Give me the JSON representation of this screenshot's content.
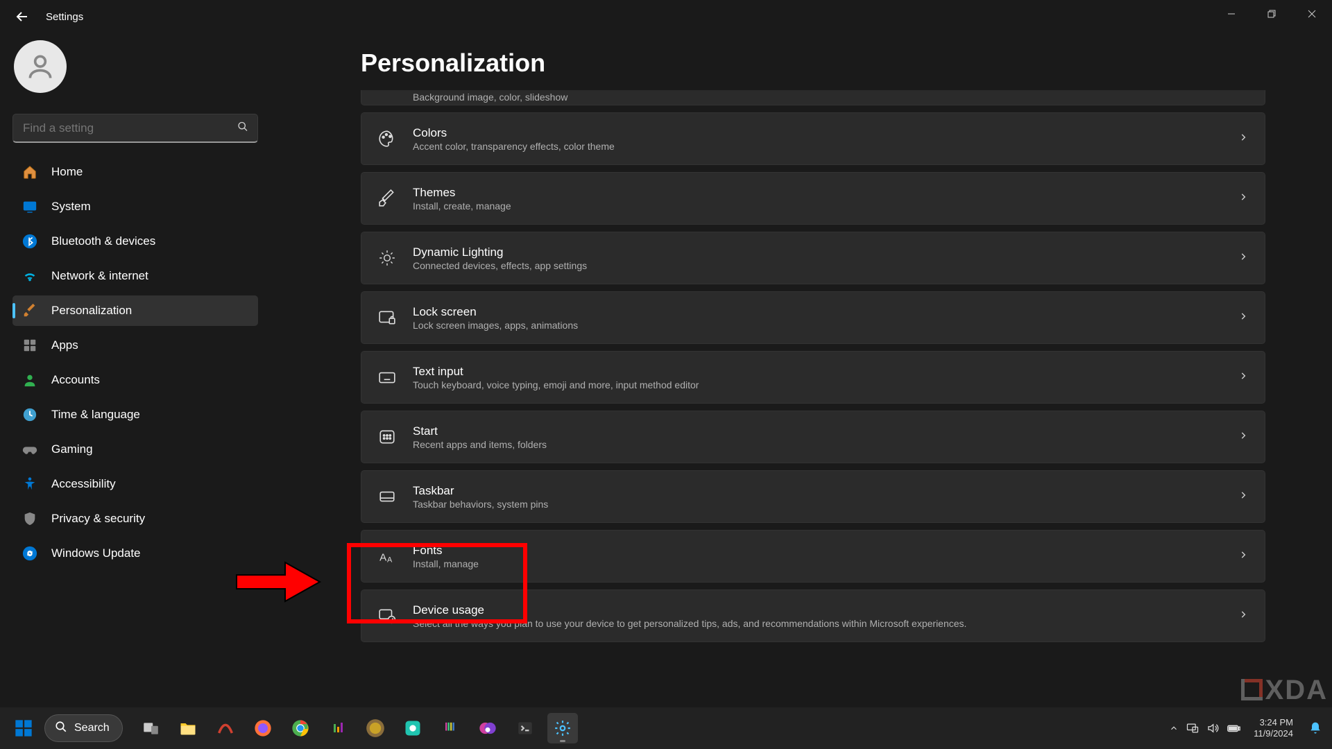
{
  "window": {
    "title": "Settings"
  },
  "page": {
    "heading": "Personalization"
  },
  "search": {
    "placeholder": "Find a setting"
  },
  "nav": [
    {
      "label": "Home"
    },
    {
      "label": "System"
    },
    {
      "label": "Bluetooth & devices"
    },
    {
      "label": "Network & internet"
    },
    {
      "label": "Personalization"
    },
    {
      "label": "Apps"
    },
    {
      "label": "Accounts"
    },
    {
      "label": "Time & language"
    },
    {
      "label": "Gaming"
    },
    {
      "label": "Accessibility"
    },
    {
      "label": "Privacy & security"
    },
    {
      "label": "Windows Update"
    }
  ],
  "cards": {
    "background_sub": "Background image, color, slideshow",
    "colors": {
      "title": "Colors",
      "sub": "Accent color, transparency effects, color theme"
    },
    "themes": {
      "title": "Themes",
      "sub": "Install, create, manage"
    },
    "dynamic": {
      "title": "Dynamic Lighting",
      "sub": "Connected devices, effects, app settings"
    },
    "lock": {
      "title": "Lock screen",
      "sub": "Lock screen images, apps, animations"
    },
    "text": {
      "title": "Text input",
      "sub": "Touch keyboard, voice typing, emoji and more, input method editor"
    },
    "start": {
      "title": "Start",
      "sub": "Recent apps and items, folders"
    },
    "taskbar": {
      "title": "Taskbar",
      "sub": "Taskbar behaviors, system pins"
    },
    "fonts": {
      "title": "Fonts",
      "sub": "Install, manage"
    },
    "device": {
      "title": "Device usage",
      "sub": "Select all the ways you plan to use your device to get personalized tips, ads, and recommendations within Microsoft experiences."
    }
  },
  "taskbar": {
    "search": "Search"
  },
  "systray": {
    "time": "3:24 PM",
    "date": "11/9/2024"
  },
  "watermark": "XDA"
}
